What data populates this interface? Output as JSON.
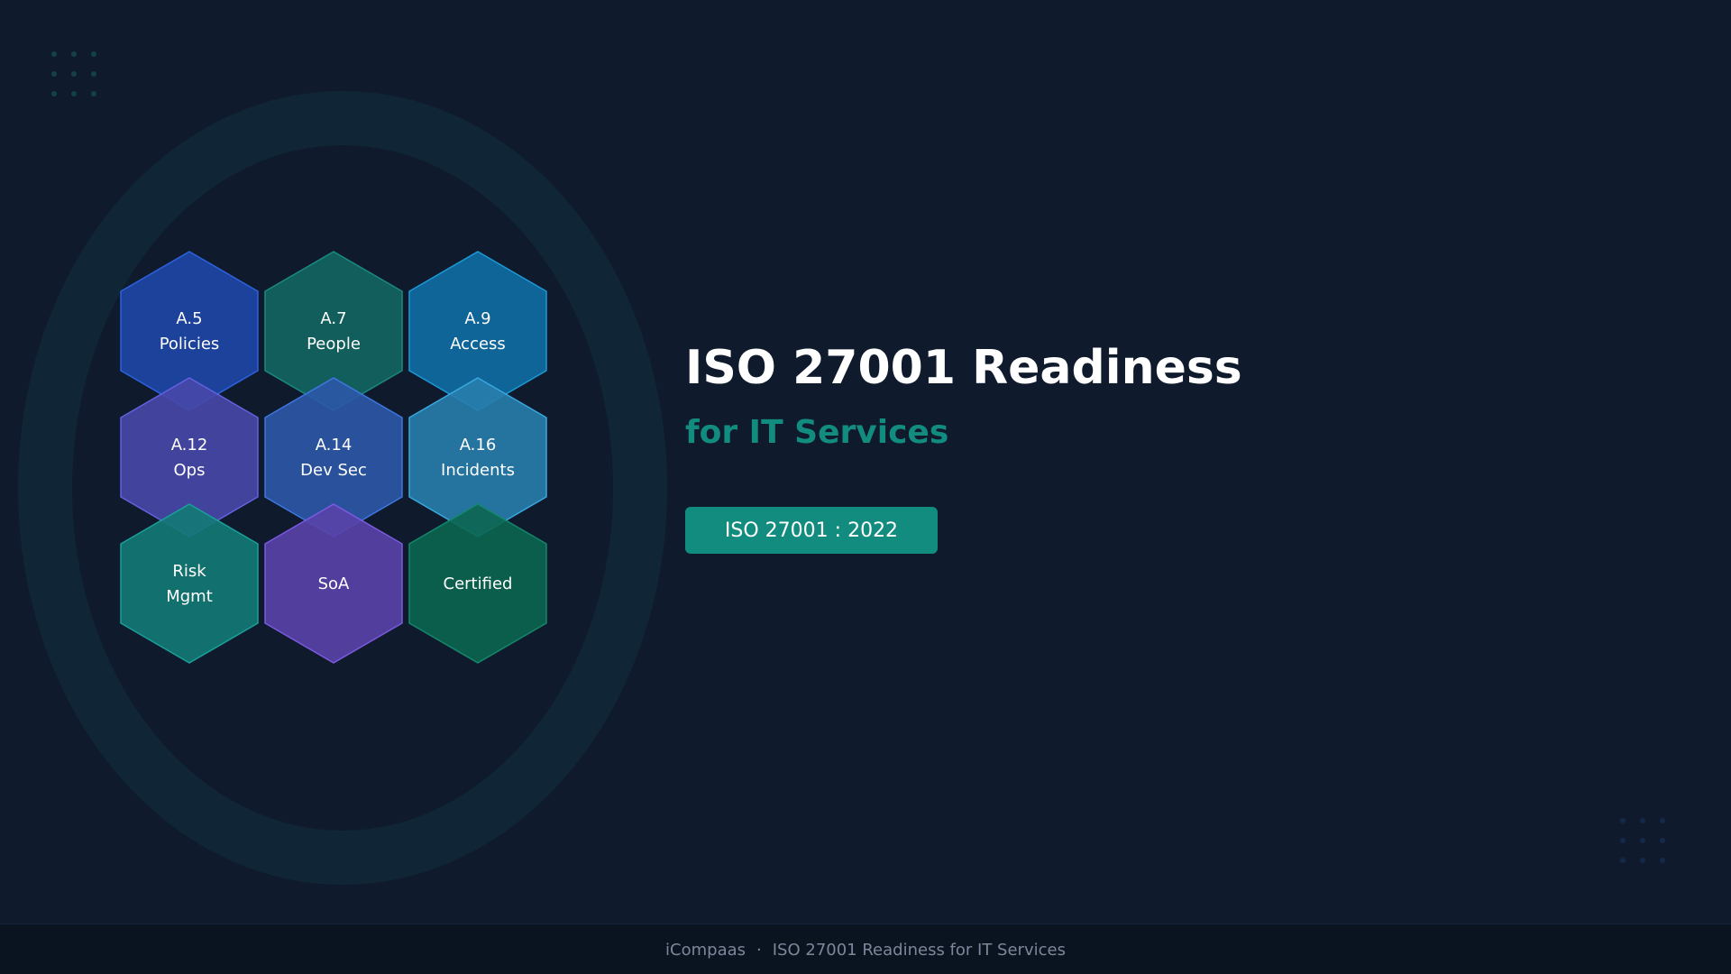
{
  "colors": {
    "background": "#0f1b2d",
    "accent": "#138c80",
    "title": "#ffffff",
    "footer_text": "#7c8799"
  },
  "hexagons": [
    {
      "lines": [
        "A.5",
        "Policies"
      ],
      "fill": "#1e47a8",
      "stroke": "#2d63e0"
    },
    {
      "lines": [
        "A.7",
        "People"
      ],
      "fill": "#136663",
      "stroke": "#1a8a82"
    },
    {
      "lines": [
        "A.9",
        "Access"
      ],
      "fill": "#0f6ea3",
      "stroke": "#1c9ad8"
    },
    {
      "lines": [
        "A.12",
        "Ops"
      ],
      "fill": "#4848a8",
      "stroke": "#6262e0"
    },
    {
      "lines": [
        "A.14",
        "Dev Sec"
      ],
      "fill": "#2c58a8",
      "stroke": "#3d78e0"
    },
    {
      "lines": [
        "A.16",
        "Incidents"
      ],
      "fill": "#287ead",
      "stroke": "#38a8e0"
    },
    {
      "lines": [
        "Risk",
        "Mgmt"
      ],
      "fill": "#137a76",
      "stroke": "#1aa09a"
    },
    {
      "lines": [
        "SoA"
      ],
      "fill": "#5a42a8",
      "stroke": "#7a5ae0"
    },
    {
      "lines": [
        "Certified"
      ],
      "fill": "#0c6650",
      "stroke": "#14886c"
    }
  ],
  "title": "ISO 27001 Readiness",
  "subtitle": "for IT Services",
  "badge": "ISO 27001 : 2022",
  "footer": {
    "brand": "iCompaas",
    "separator": "·",
    "text": "ISO 27001 Readiness for IT Services"
  }
}
